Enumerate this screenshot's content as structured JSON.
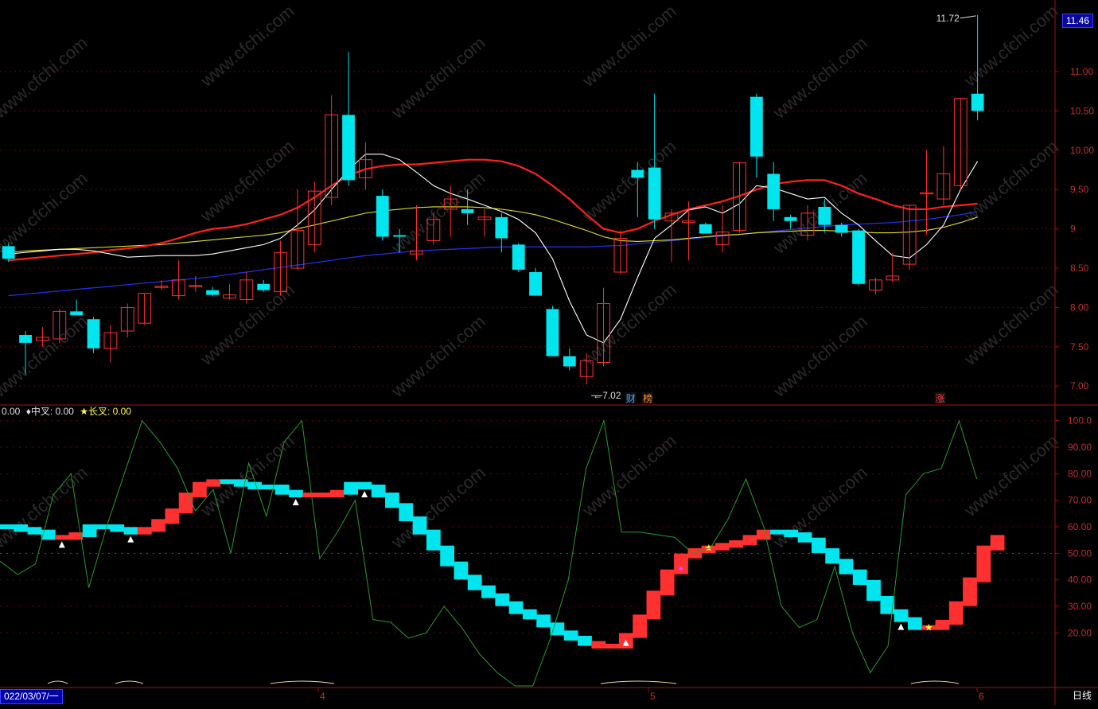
{
  "price_panel": {
    "y_ticks": [
      "11.00",
      "10.50",
      "10.00",
      "9.50",
      "9",
      "8.50",
      "8.00",
      "7.50",
      "7.00"
    ],
    "current_price": "11.46",
    "high_label": "11.72",
    "low_label": "7.02",
    "markers": [
      {
        "text": "财",
        "color": "#4aa0ff"
      },
      {
        "text": "榜",
        "color": "#ff9030"
      },
      {
        "text": "涨",
        "color": "#ff4040"
      }
    ]
  },
  "indicator_panel": {
    "legend": {
      "first": "0.00",
      "mid": "♦中叉: 0.00",
      "long": "★长叉: 0.00"
    },
    "y_ticks": [
      "100.0",
      "90.00",
      "80.00",
      "70.00",
      "60.00",
      "50.00",
      "40.00",
      "30.00",
      "20.00"
    ]
  },
  "x_axis": {
    "date_label": "022/03/07/一",
    "month_ticks": [
      "4",
      "5",
      "6"
    ],
    "period": "日线"
  },
  "colors": {
    "up": "#ff3030",
    "down": "#00e5ee",
    "ma5": "#ffffff",
    "ma10": "#ff2020",
    "ma20": "#e0e020",
    "ma60": "#2030e0",
    "osc": "#2a9a2a"
  },
  "chart_data": [
    {
      "type": "candlestick",
      "title": "",
      "ylim": [
        6.85,
        11.78
      ],
      "candles": [
        {
          "o": 8.78,
          "h": 8.82,
          "l": 8.58,
          "c": 8.62
        },
        {
          "o": 7.65,
          "h": 7.7,
          "l": 7.15,
          "c": 7.55
        },
        {
          "o": 7.58,
          "h": 7.75,
          "l": 7.5,
          "c": 7.62
        },
        {
          "o": 7.6,
          "h": 7.98,
          "l": 7.55,
          "c": 7.95
        },
        {
          "o": 7.95,
          "h": 8.1,
          "l": 7.9,
          "c": 7.9
        },
        {
          "o": 7.85,
          "h": 7.88,
          "l": 7.42,
          "c": 7.48
        },
        {
          "o": 7.48,
          "h": 7.78,
          "l": 7.3,
          "c": 7.68
        },
        {
          "o": 7.7,
          "h": 8.05,
          "l": 7.62,
          "c": 8.0
        },
        {
          "o": 7.8,
          "h": 8.18,
          "l": 7.78,
          "c": 8.18
        },
        {
          "o": 8.27,
          "h": 8.35,
          "l": 8.22,
          "c": 8.27
        },
        {
          "o": 8.15,
          "h": 8.6,
          "l": 8.1,
          "c": 8.35
        },
        {
          "o": 8.28,
          "h": 8.4,
          "l": 8.2,
          "c": 8.28
        },
        {
          "o": 8.22,
          "h": 8.26,
          "l": 8.14,
          "c": 8.16
        },
        {
          "o": 8.12,
          "h": 8.3,
          "l": 8.1,
          "c": 8.16
        },
        {
          "o": 8.1,
          "h": 8.45,
          "l": 8.05,
          "c": 8.35
        },
        {
          "o": 8.3,
          "h": 8.35,
          "l": 8.2,
          "c": 8.22
        },
        {
          "o": 8.2,
          "h": 8.85,
          "l": 8.15,
          "c": 8.7
        },
        {
          "o": 8.5,
          "h": 9.5,
          "l": 8.48,
          "c": 8.98
        },
        {
          "o": 8.8,
          "h": 9.6,
          "l": 8.7,
          "c": 9.48
        },
        {
          "o": 9.4,
          "h": 10.7,
          "l": 9.3,
          "c": 10.45
        },
        {
          "o": 10.45,
          "h": 11.25,
          "l": 9.55,
          "c": 9.62
        },
        {
          "o": 9.65,
          "h": 10.1,
          "l": 9.5,
          "c": 9.88
        },
        {
          "o": 9.42,
          "h": 9.5,
          "l": 8.85,
          "c": 8.9
        },
        {
          "o": 8.92,
          "h": 9.0,
          "l": 8.7,
          "c": 8.9
        },
        {
          "o": 8.68,
          "h": 9.3,
          "l": 8.6,
          "c": 8.72
        },
        {
          "o": 8.85,
          "h": 9.2,
          "l": 8.8,
          "c": 9.12
        },
        {
          "o": 9.25,
          "h": 9.55,
          "l": 8.9,
          "c": 9.38
        },
        {
          "o": 9.25,
          "h": 9.5,
          "l": 9.05,
          "c": 9.2
        },
        {
          "o": 9.12,
          "h": 9.25,
          "l": 8.9,
          "c": 9.15
        },
        {
          "o": 9.15,
          "h": 9.2,
          "l": 8.7,
          "c": 8.88
        },
        {
          "o": 8.8,
          "h": 8.82,
          "l": 8.45,
          "c": 8.48
        },
        {
          "o": 8.45,
          "h": 8.5,
          "l": 8.15,
          "c": 8.15
        },
        {
          "o": 7.98,
          "h": 8.02,
          "l": 7.38,
          "c": 7.38
        },
        {
          "o": 7.38,
          "h": 7.48,
          "l": 7.2,
          "c": 7.25
        },
        {
          "o": 7.12,
          "h": 7.42,
          "l": 7.02,
          "c": 7.32
        },
        {
          "o": 7.3,
          "h": 8.25,
          "l": 7.25,
          "c": 8.05
        },
        {
          "o": 8.45,
          "h": 8.98,
          "l": 8.42,
          "c": 8.88
        },
        {
          "o": 9.75,
          "h": 9.85,
          "l": 9.15,
          "c": 9.65
        },
        {
          "o": 9.78,
          "h": 10.72,
          "l": 9.0,
          "c": 9.12
        },
        {
          "o": 9.1,
          "h": 9.25,
          "l": 8.58,
          "c": 9.2
        },
        {
          "o": 9.08,
          "h": 9.35,
          "l": 8.6,
          "c": 9.1
        },
        {
          "o": 9.06,
          "h": 9.08,
          "l": 8.94,
          "c": 8.94
        },
        {
          "o": 8.8,
          "h": 9.3,
          "l": 8.7,
          "c": 8.96
        },
        {
          "o": 8.98,
          "h": 9.85,
          "l": 8.95,
          "c": 9.84
        },
        {
          "o": 10.68,
          "h": 10.72,
          "l": 9.65,
          "c": 9.92
        },
        {
          "o": 9.7,
          "h": 9.85,
          "l": 9.1,
          "c": 9.25
        },
        {
          "o": 9.15,
          "h": 9.18,
          "l": 9.0,
          "c": 9.1
        },
        {
          "o": 8.92,
          "h": 9.3,
          "l": 8.85,
          "c": 9.2
        },
        {
          "o": 9.28,
          "h": 9.38,
          "l": 8.95,
          "c": 9.05
        },
        {
          "o": 9.05,
          "h": 9.08,
          "l": 8.9,
          "c": 8.95
        },
        {
          "o": 8.98,
          "h": 9.0,
          "l": 8.28,
          "c": 8.3
        },
        {
          "o": 8.22,
          "h": 8.38,
          "l": 8.16,
          "c": 8.35
        },
        {
          "o": 8.35,
          "h": 8.7,
          "l": 8.32,
          "c": 8.4
        },
        {
          "o": 8.55,
          "h": 9.3,
          "l": 8.48,
          "c": 9.3
        },
        {
          "o": 9.45,
          "h": 10.0,
          "l": 8.92,
          "c": 9.46
        },
        {
          "o": 9.38,
          "h": 10.05,
          "l": 9.3,
          "c": 9.7
        },
        {
          "o": 9.55,
          "h": 10.66,
          "l": 9.5,
          "c": 10.66
        },
        {
          "o": 10.72,
          "h": 11.72,
          "l": 10.38,
          "c": 10.5
        }
      ],
      "ma5": [
        8.68,
        8.7,
        8.72,
        8.74,
        8.74,
        8.72,
        8.68,
        8.64,
        8.65,
        8.66,
        8.66,
        8.66,
        8.68,
        8.72,
        8.76,
        8.8,
        8.88,
        9.05,
        9.24,
        9.5,
        9.75,
        9.95,
        9.95,
        9.88,
        9.72,
        9.55,
        9.45,
        9.38,
        9.3,
        9.22,
        9.12,
        8.95,
        8.62,
        8.08,
        7.65,
        7.55,
        7.85,
        8.38,
        8.88,
        9.05,
        9.24,
        9.28,
        9.2,
        9.32,
        9.55,
        9.52,
        9.45,
        9.38,
        9.4,
        9.2,
        9.05,
        8.85,
        8.66,
        8.63,
        8.8,
        9.05,
        9.5,
        9.86
      ],
      "ma10": [
        8.6,
        8.62,
        8.64,
        8.66,
        8.68,
        8.7,
        8.73,
        8.75,
        8.78,
        8.82,
        8.88,
        8.95,
        9.0,
        9.02,
        9.06,
        9.12,
        9.18,
        9.27,
        9.4,
        9.55,
        9.68,
        9.76,
        9.8,
        9.82,
        9.82,
        9.84,
        9.86,
        9.88,
        9.88,
        9.86,
        9.8,
        9.7,
        9.55,
        9.38,
        9.18,
        9.0,
        8.95,
        9.0,
        9.1,
        9.18,
        9.25,
        9.3,
        9.35,
        9.42,
        9.5,
        9.57,
        9.6,
        9.62,
        9.62,
        9.55,
        9.45,
        9.38,
        9.3,
        9.25,
        9.25,
        9.28,
        9.3,
        9.32
      ],
      "ma20": [
        8.7,
        8.72,
        8.73,
        8.74,
        8.75,
        8.76,
        8.77,
        8.78,
        8.79,
        8.8,
        8.82,
        8.84,
        8.86,
        8.88,
        8.9,
        8.92,
        8.95,
        9.0,
        9.05,
        9.1,
        9.15,
        9.2,
        9.23,
        9.25,
        9.27,
        9.28,
        9.28,
        9.28,
        9.27,
        9.25,
        9.22,
        9.18,
        9.12,
        9.05,
        8.98,
        8.9,
        8.85,
        8.84,
        8.85,
        8.86,
        8.88,
        8.9,
        8.92,
        8.93,
        8.95,
        8.96,
        8.97,
        8.98,
        8.98,
        8.97,
        8.96,
        8.95,
        8.95,
        8.96,
        8.98,
        9.02,
        9.08,
        9.15
      ],
      "ma60": [
        8.15,
        8.17,
        8.19,
        8.21,
        8.23,
        8.25,
        8.27,
        8.29,
        8.31,
        8.33,
        8.35,
        8.37,
        8.39,
        8.42,
        8.45,
        8.48,
        8.51,
        8.54,
        8.57,
        8.6,
        8.63,
        8.66,
        8.68,
        8.7,
        8.72,
        8.73,
        8.74,
        8.75,
        8.76,
        8.77,
        8.77,
        8.77,
        8.77,
        8.77,
        8.77,
        8.78,
        8.79,
        8.81,
        8.83,
        8.85,
        8.87,
        8.89,
        8.91,
        8.93,
        8.95,
        8.97,
        8.99,
        9.01,
        9.03,
        9.05,
        9.06,
        9.07,
        9.08,
        9.1,
        9.12,
        9.15,
        9.18,
        9.22
      ],
      "close_marks": [
        {
          "i": 0,
          "v": 7.58
        },
        {
          "i": 1,
          "v": 7.58
        },
        {
          "i": 2,
          "v": 7.62
        },
        {
          "i": 3,
          "v": 7.78
        },
        {
          "i": 4,
          "v": 8.03
        },
        {
          "i": 5,
          "v": 8.28
        }
      ]
    },
    {
      "type": "step",
      "title": "",
      "ylim": [
        0,
        105
      ],
      "values": [
        60,
        59,
        58,
        56,
        56,
        57,
        60,
        60,
        59,
        58,
        59,
        62,
        66,
        72,
        76,
        77,
        77,
        76,
        75,
        75,
        73,
        72,
        72,
        72,
        73,
        76,
        75,
        72,
        68,
        63,
        58,
        52,
        46,
        41,
        37,
        34,
        31,
        28,
        26,
        23,
        20,
        18,
        16,
        15,
        15,
        19,
        26,
        35,
        43,
        49,
        51,
        52,
        53,
        54,
        56,
        58,
        58,
        57,
        55,
        51,
        47,
        43,
        39,
        33,
        28,
        25,
        22,
        22,
        24,
        31,
        40,
        52,
        56
      ],
      "colors_up": [
        false,
        false,
        false,
        false,
        true,
        true,
        false,
        false,
        false,
        false,
        true,
        true,
        true,
        true,
        true,
        true,
        false,
        false,
        false,
        false,
        false,
        false,
        true,
        true,
        true,
        false,
        false,
        false,
        false,
        false,
        false,
        false,
        false,
        false,
        false,
        false,
        false,
        false,
        false,
        false,
        false,
        false,
        false,
        true,
        true,
        true,
        true,
        true,
        true,
        true,
        true,
        true,
        true,
        true,
        true,
        true,
        false,
        false,
        false,
        false,
        false,
        false,
        false,
        false,
        false,
        false,
        false,
        true,
        true,
        true,
        true,
        true,
        true
      ],
      "oscillator": [
        47,
        42,
        46,
        72,
        80,
        37,
        60,
        80,
        100,
        92,
        82,
        66,
        74,
        50,
        84,
        64,
        92,
        100,
        48,
        58,
        70,
        25,
        24,
        18,
        20,
        30,
        22,
        12,
        5,
        0,
        0,
        18,
        40,
        82,
        100,
        58,
        58,
        57,
        56,
        50,
        52,
        63,
        78,
        60,
        30,
        22,
        25,
        45,
        20,
        5,
        15,
        72,
        80,
        82,
        100,
        78
      ],
      "triangle_marks": [
        4,
        9,
        21,
        26,
        45,
        65
      ],
      "star_marks": [
        51,
        67
      ],
      "diamond_marks": [
        49
      ]
    }
  ]
}
